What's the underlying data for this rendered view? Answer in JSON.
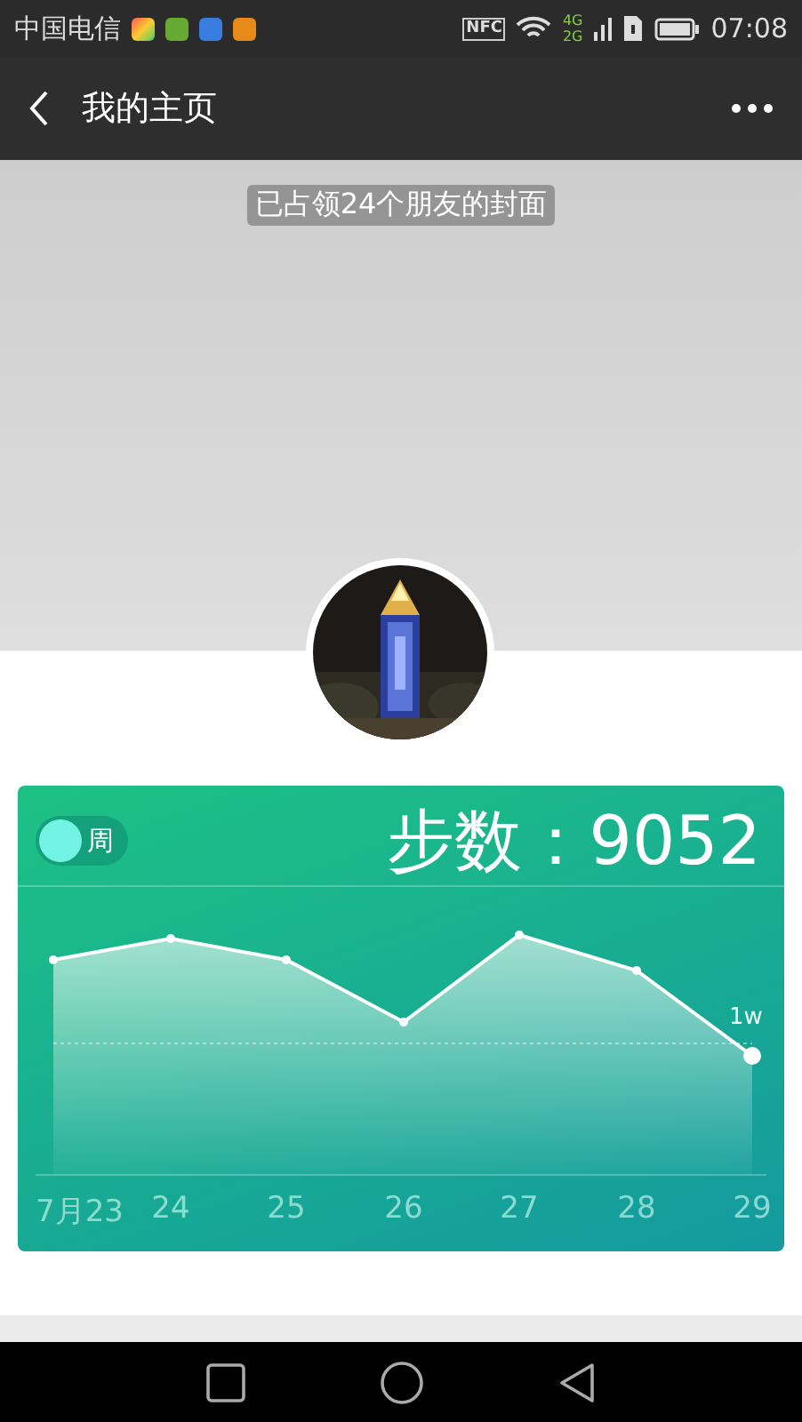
{
  "status_bar": {
    "carrier": "中国电信",
    "nfc": "NFC",
    "net_top": "4G",
    "net_bottom": "2G",
    "time": "07:08"
  },
  "header": {
    "title": "我的主页"
  },
  "cover": {
    "caption": "已占领24个朋友的封面"
  },
  "steps_card": {
    "period": "周",
    "steps": "步数：9052",
    "reference_label": "1w",
    "x_labels": [
      "7月23",
      "24",
      "25",
      "26",
      "27",
      "28",
      "29"
    ]
  }
}
